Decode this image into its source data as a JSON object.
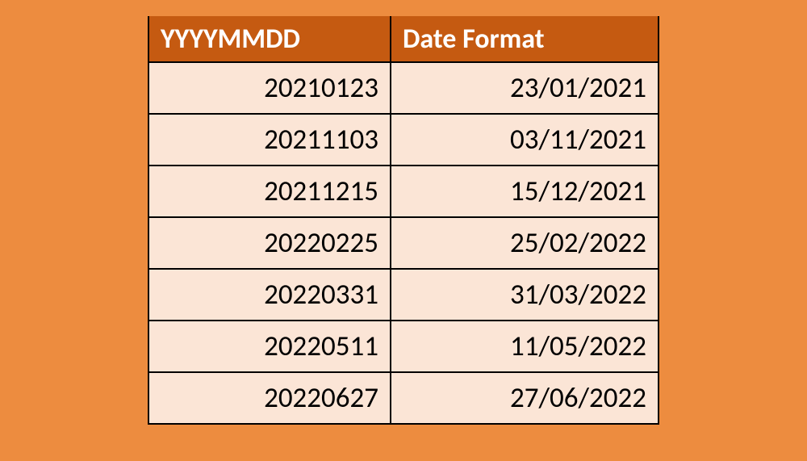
{
  "table": {
    "headers": [
      "YYYYMMDD",
      "Date Format"
    ],
    "rows": [
      {
        "yyyymmdd": "20210123",
        "formatted": "23/01/2021"
      },
      {
        "yyyymmdd": "20211103",
        "formatted": "03/11/2021"
      },
      {
        "yyyymmdd": "20211215",
        "formatted": "15/12/2021"
      },
      {
        "yyyymmdd": "20220225",
        "formatted": "25/02/2022"
      },
      {
        "yyyymmdd": "20220331",
        "formatted": "31/03/2022"
      },
      {
        "yyyymmdd": "20220511",
        "formatted": "11/05/2022"
      },
      {
        "yyyymmdd": "20220627",
        "formatted": "27/06/2022"
      }
    ]
  },
  "chart_data": {
    "type": "table",
    "title": "",
    "columns": [
      "YYYYMMDD",
      "Date Format"
    ],
    "data": [
      [
        "20210123",
        "23/01/2021"
      ],
      [
        "20211103",
        "03/11/2021"
      ],
      [
        "20211215",
        "15/12/2021"
      ],
      [
        "20220225",
        "25/02/2022"
      ],
      [
        "20220331",
        "31/03/2022"
      ],
      [
        "20220511",
        "11/05/2022"
      ],
      [
        "20220627",
        "27/06/2022"
      ]
    ]
  }
}
